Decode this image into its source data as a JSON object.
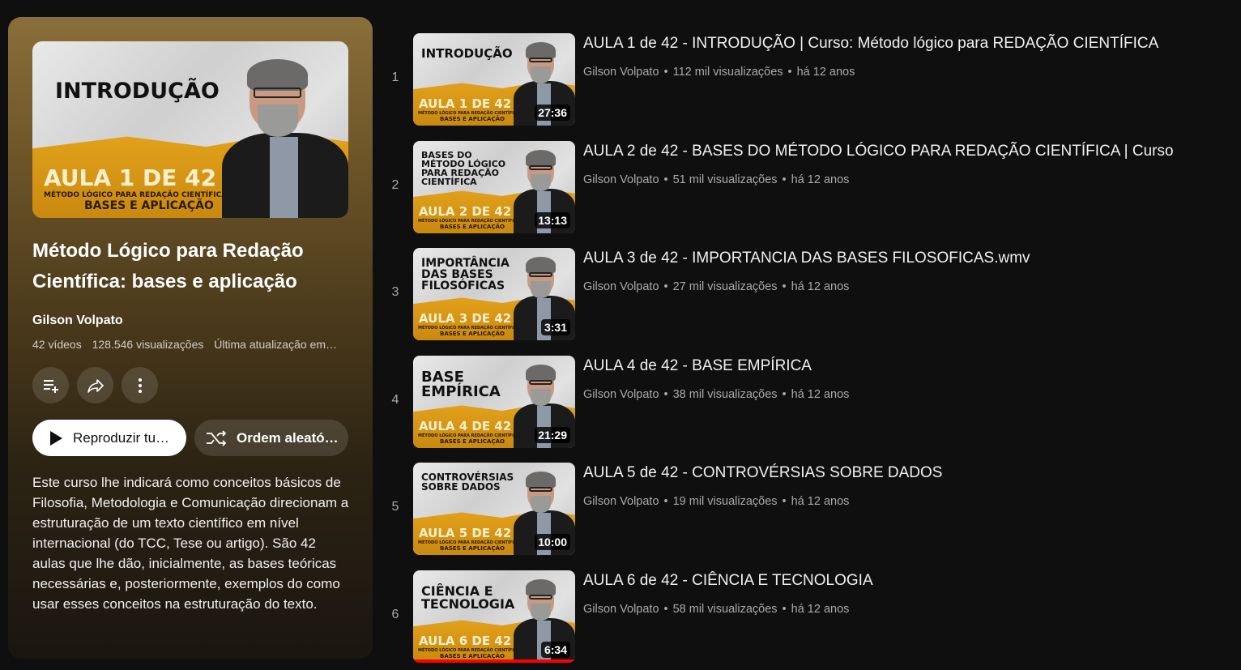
{
  "playlist": {
    "thumb": {
      "heading": "INTRODUÇÃO",
      "aula": "AULA 1 DE 42",
      "sub1": "MÉTODO LÓGICO PARA REDAÇÃO CIENTÍFICA:",
      "sub2": "BASES E APLICAÇÃO"
    },
    "title": "Método Lógico para Redação Científica: bases e aplicação",
    "channel": "Gilson Volpato",
    "video_count": "42 vídeos",
    "views": "128.546 visualizações",
    "updated": "Última atualização em…",
    "play_all_label": "Reproduzir tu…",
    "shuffle_label": "Ordem aleató…",
    "description": "Este curso lhe indicará como conceitos básicos de Filosofia, Metodologia e Comunicação direcionam a estruturação de um texto científico em nível internacional (do TCC, Tese ou artigo). São 42 aulas que lhe dão, inicialmente, as bases teóricas necessárias e, posteriormente, exemplos do como usar esses conceitos na estruturação do texto."
  },
  "videos": [
    {
      "index": "1",
      "title": "AULA 1 de 42 - INTRODUÇÃO | Curso: Método lógico para REDAÇÃO CIENTÍFICA",
      "channel": "Gilson Volpato",
      "views": "112 mil visualizações",
      "age": "há 12 anos",
      "duration": "27:36",
      "thumb_heading": "INTRODUÇÃO",
      "thumb_aula": "AULA 1 DE 42"
    },
    {
      "index": "2",
      "title": "AULA 2 de 42 - BASES DO MÉTODO LÓGICO PARA REDAÇÃO CIENTÍFICA | Curso",
      "channel": "Gilson Volpato",
      "views": "51 mil visualizações",
      "age": "há 12 anos",
      "duration": "13:13",
      "thumb_heading": "BASES DO MÉTODO LÓGICO PARA REDAÇÃO CIENTÍFICA",
      "thumb_aula": "AULA 2 DE 42"
    },
    {
      "index": "3",
      "title": "AULA 3 de 42 - IMPORTANCIA DAS BASES FILOSOFICAS.wmv",
      "channel": "Gilson Volpato",
      "views": "27 mil visualizações",
      "age": "há 12 anos",
      "duration": "3:31",
      "thumb_heading": "IMPORTÂNCIA DAS BASES FILOSÓFICAS",
      "thumb_aula": "AULA 3 DE 42"
    },
    {
      "index": "4",
      "title": "AULA 4 de 42 - BASE EMPÍRICA",
      "channel": "Gilson Volpato",
      "views": "38 mil visualizações",
      "age": "há 12 anos",
      "duration": "21:29",
      "thumb_heading": "BASE EMPÍRICA",
      "thumb_aula": "AULA 4 DE 42"
    },
    {
      "index": "5",
      "title": "AULA 5 de 42 - CONTROVÉRSIAS SOBRE DADOS",
      "channel": "Gilson Volpato",
      "views": "19 mil visualizações",
      "age": "há 12 anos",
      "duration": "10:00",
      "thumb_heading": "CONTROVÉRSIAS SOBRE DADOS",
      "thumb_aula": "AULA 5 DE 42"
    },
    {
      "index": "6",
      "title": "AULA 6 de 42 - CIÊNCIA E TECNOLOGIA",
      "channel": "Gilson Volpato",
      "views": "58 mil visualizações",
      "age": "há 12 anos",
      "duration": "6:34",
      "thumb_heading": "CIÊNCIA E TECNOLOGIA",
      "thumb_aula": "AULA 6 DE 42",
      "watched": 1.0
    }
  ],
  "thumb_subtitle": {
    "line1": "MÉTODO LÓGICO PARA REDAÇÃO CIENTÍFICA:",
    "line2": "BASES E APLICAÇÃO"
  },
  "icons": {
    "save": "playlist-add-icon",
    "share": "share-icon",
    "more": "more-vert-icon",
    "play": "play-icon",
    "shuffle": "shuffle-icon"
  },
  "colors": {
    "accent_yellow": "#e3a21a",
    "progress": "#ff0000",
    "background": "#0f0f0f"
  }
}
